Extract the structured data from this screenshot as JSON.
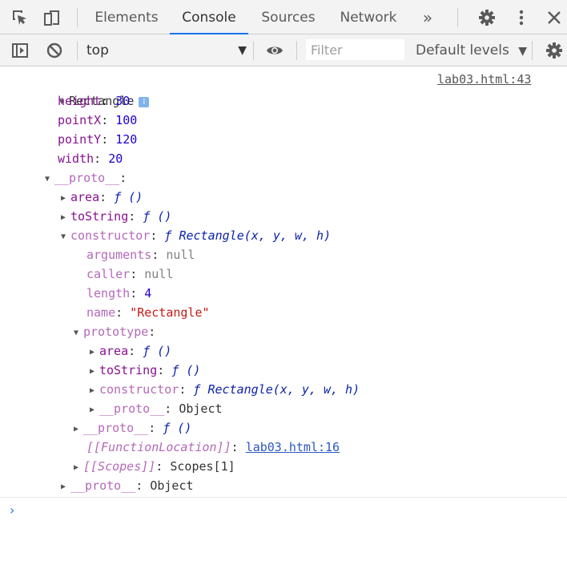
{
  "tabs": [
    {
      "label": "Elements"
    },
    {
      "label": "Console"
    },
    {
      "label": "Sources"
    },
    {
      "label": "Network"
    }
  ],
  "more_tabs": "»",
  "toolbar": {
    "context": "top",
    "filter_placeholder": "Filter",
    "levels": "Default levels"
  },
  "log": {
    "title": "Rectangle",
    "info": "i",
    "source": "lab03.html:43"
  },
  "tree": [
    {
      "tokens": [
        {
          "t": "key",
          "v": "height"
        },
        {
          "t": "plain",
          "v": ": "
        },
        {
          "t": "num",
          "v": "30"
        }
      ]
    },
    {
      "tokens": [
        {
          "t": "key",
          "v": "pointX"
        },
        {
          "t": "plain",
          "v": ": "
        },
        {
          "t": "num",
          "v": "100"
        }
      ]
    },
    {
      "tokens": [
        {
          "t": "key",
          "v": "pointY"
        },
        {
          "t": "plain",
          "v": ": "
        },
        {
          "t": "num",
          "v": "120"
        }
      ]
    },
    {
      "tokens": [
        {
          "t": "key",
          "v": "width"
        },
        {
          "t": "plain",
          "v": ": "
        },
        {
          "t": "num",
          "v": "20"
        }
      ]
    },
    {
      "arrow": "down",
      "tokens": [
        {
          "t": "key-dim",
          "v": "__proto__"
        },
        {
          "t": "plain",
          "v": ":"
        }
      ]
    },
    {
      "arrow": "right",
      "tokens": [
        {
          "t": "key",
          "v": "area"
        },
        {
          "t": "plain",
          "v": ": "
        },
        {
          "t": "fn",
          "v": "ƒ ()"
        }
      ]
    },
    {
      "arrow": "right",
      "tokens": [
        {
          "t": "key",
          "v": "toString"
        },
        {
          "t": "plain",
          "v": ": "
        },
        {
          "t": "fn",
          "v": "ƒ ()"
        }
      ]
    },
    {
      "arrow": "down",
      "tokens": [
        {
          "t": "key-dim",
          "v": "constructor"
        },
        {
          "t": "plain",
          "v": ": "
        },
        {
          "t": "fn",
          "v": "ƒ Rectangle(x, y, w, h)"
        }
      ]
    },
    {
      "tokens": [
        {
          "t": "key-dim",
          "v": "arguments"
        },
        {
          "t": "plain",
          "v": ": "
        },
        {
          "t": "nul",
          "v": "null"
        }
      ]
    },
    {
      "tokens": [
        {
          "t": "key-dim",
          "v": "caller"
        },
        {
          "t": "plain",
          "v": ": "
        },
        {
          "t": "nul",
          "v": "null"
        }
      ]
    },
    {
      "tokens": [
        {
          "t": "key-dim",
          "v": "length"
        },
        {
          "t": "plain",
          "v": ": "
        },
        {
          "t": "num",
          "v": "4"
        }
      ]
    },
    {
      "tokens": [
        {
          "t": "key-dim",
          "v": "name"
        },
        {
          "t": "plain",
          "v": ": "
        },
        {
          "t": "str",
          "v": "\"Rectangle\""
        }
      ]
    },
    {
      "arrow": "down",
      "tokens": [
        {
          "t": "key-dim",
          "v": "prototype"
        },
        {
          "t": "plain",
          "v": ":"
        }
      ]
    },
    {
      "arrow": "right",
      "tokens": [
        {
          "t": "key",
          "v": "area"
        },
        {
          "t": "plain",
          "v": ": "
        },
        {
          "t": "fn",
          "v": "ƒ ()"
        }
      ]
    },
    {
      "arrow": "right",
      "tokens": [
        {
          "t": "key",
          "v": "toString"
        },
        {
          "t": "plain",
          "v": ": "
        },
        {
          "t": "fn",
          "v": "ƒ ()"
        }
      ]
    },
    {
      "arrow": "right",
      "tokens": [
        {
          "t": "key-dim",
          "v": "constructor"
        },
        {
          "t": "plain",
          "v": ": "
        },
        {
          "t": "fn",
          "v": "ƒ Rectangle(x, y, w, h)"
        }
      ]
    },
    {
      "arrow": "right",
      "tokens": [
        {
          "t": "key-dim",
          "v": "__proto__"
        },
        {
          "t": "plain",
          "v": ": Object"
        }
      ]
    },
    {
      "arrow": "right",
      "tokens": [
        {
          "t": "key-dim",
          "v": "__proto__"
        },
        {
          "t": "plain",
          "v": ": "
        },
        {
          "t": "fn",
          "v": "ƒ ()"
        }
      ]
    },
    {
      "tokens": [
        {
          "t": "key-dim",
          "v": "[[FunctionLocation]]",
          "i": true
        },
        {
          "t": "plain",
          "v": ": "
        },
        {
          "t": "link",
          "v": "lab03.html:16"
        }
      ]
    },
    {
      "arrow": "right",
      "tokens": [
        {
          "t": "key-dim",
          "v": "[[Scopes]]",
          "i": true
        },
        {
          "t": "plain",
          "v": ": Scopes[1]"
        }
      ]
    },
    {
      "arrow": "right",
      "tokens": [
        {
          "t": "key-dim",
          "v": "__proto__"
        },
        {
          "t": "plain",
          "v": ": Object"
        }
      ]
    }
  ],
  "prompt": "›",
  "colors": {
    "accent": "#1a73e8",
    "key": "#881391",
    "number": "#1c00cf",
    "string": "#c41a16"
  },
  "icons": [
    "inspect-icon",
    "device-toggle-icon",
    "settings-icon",
    "kebab-menu-icon",
    "close-icon",
    "sidebar-toggle-icon",
    "clear-icon",
    "eye-icon"
  ]
}
